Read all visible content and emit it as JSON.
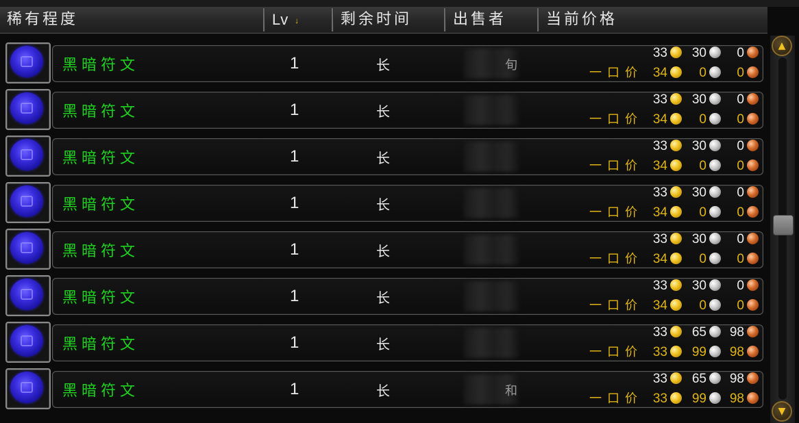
{
  "header": {
    "col_rarity": "稀有程度",
    "col_level": "Lv",
    "sort_indicator": "↓",
    "col_time_left": "剩余时间",
    "col_seller": "出售者",
    "col_current_price": "当前价格"
  },
  "buyout_label": "一口价",
  "rows": [
    {
      "item_name": "黑暗符文",
      "level": "1",
      "time_left": "长",
      "seller_visible": "旬",
      "bid": {
        "gold": "33",
        "silver": "30",
        "copper": "0"
      },
      "buyout": {
        "gold": "34",
        "silver": "0",
        "copper": "0"
      }
    },
    {
      "item_name": "黑暗符文",
      "level": "1",
      "time_left": "长",
      "seller_visible": "",
      "bid": {
        "gold": "33",
        "silver": "30",
        "copper": "0"
      },
      "buyout": {
        "gold": "34",
        "silver": "0",
        "copper": "0"
      }
    },
    {
      "item_name": "黑暗符文",
      "level": "1",
      "time_left": "长",
      "seller_visible": "",
      "bid": {
        "gold": "33",
        "silver": "30",
        "copper": "0"
      },
      "buyout": {
        "gold": "34",
        "silver": "0",
        "copper": "0"
      }
    },
    {
      "item_name": "黑暗符文",
      "level": "1",
      "time_left": "长",
      "seller_visible": "",
      "bid": {
        "gold": "33",
        "silver": "30",
        "copper": "0"
      },
      "buyout": {
        "gold": "34",
        "silver": "0",
        "copper": "0"
      }
    },
    {
      "item_name": "黑暗符文",
      "level": "1",
      "time_left": "长",
      "seller_visible": "",
      "bid": {
        "gold": "33",
        "silver": "30",
        "copper": "0"
      },
      "buyout": {
        "gold": "34",
        "silver": "0",
        "copper": "0"
      }
    },
    {
      "item_name": "黑暗符文",
      "level": "1",
      "time_left": "长",
      "seller_visible": "",
      "bid": {
        "gold": "33",
        "silver": "30",
        "copper": "0"
      },
      "buyout": {
        "gold": "34",
        "silver": "0",
        "copper": "0"
      }
    },
    {
      "item_name": "黑暗符文",
      "level": "1",
      "time_left": "长",
      "seller_visible": "",
      "bid": {
        "gold": "33",
        "silver": "65",
        "copper": "98"
      },
      "buyout": {
        "gold": "33",
        "silver": "99",
        "copper": "98"
      }
    },
    {
      "item_name": "黑暗符文",
      "level": "1",
      "time_left": "长",
      "seller_visible": "和",
      "bid": {
        "gold": "33",
        "silver": "65",
        "copper": "98"
      },
      "buyout": {
        "gold": "33",
        "silver": "99",
        "copper": "98"
      }
    }
  ],
  "icons": {
    "item": "dark-rune-icon",
    "gold": "gold-coin-icon",
    "silver": "silver-coin-icon",
    "copper": "copper-coin-icon",
    "scroll_up": "scroll-up-arrow-icon",
    "scroll_down": "scroll-down-arrow-icon"
  },
  "colors": {
    "item_name": "#1fd11f",
    "buyout": "#e1b515",
    "header_text": "#e6e6e6"
  }
}
